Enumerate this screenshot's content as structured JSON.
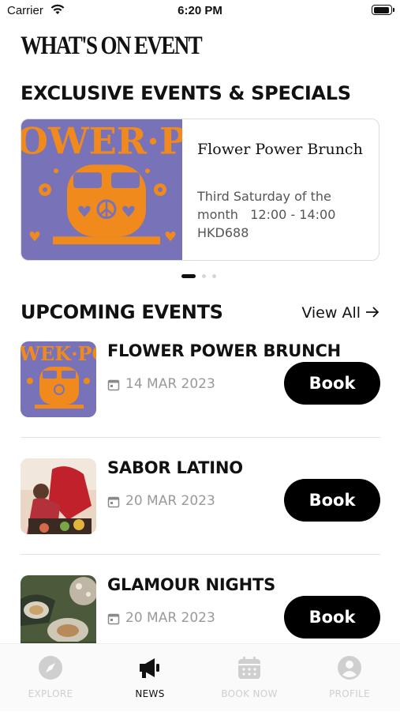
{
  "status_bar": {
    "carrier": "Carrier",
    "time": "6:20 PM"
  },
  "page_title": "WHAT'S ON EVENT",
  "sections": {
    "exclusive": "EXCLUSIVE EVENTS & SPECIALS",
    "upcoming": "UPCOMING EVENTS",
    "view_all": "View All"
  },
  "featured": {
    "title": "Flower Power Brunch",
    "schedule": "Third Saturday of the month",
    "time": "12:00 - 14:00",
    "price": "HKD688",
    "pager": {
      "count": 3,
      "active": 0
    }
  },
  "events": [
    {
      "name": "FLOWER POWER BRUNCH",
      "date": "14 MAR 2023",
      "book_label": "Book",
      "thumb": "flower-power-poster"
    },
    {
      "name": "SABOR LATINO",
      "date": "20 MAR 2023",
      "book_label": "Book",
      "thumb": "latin-dance-photo"
    },
    {
      "name": "GLAMOUR NIGHTS",
      "date": "20 MAR 2023",
      "book_label": "Book",
      "thumb": "oyster-disco-photo"
    }
  ],
  "tabs": [
    {
      "label": "EXPLORE",
      "icon": "compass-icon",
      "active": false
    },
    {
      "label": "NEWS",
      "icon": "megaphone-icon",
      "active": true
    },
    {
      "label": "BOOK NOW",
      "icon": "calendar-icon",
      "active": false
    },
    {
      "label": "PROFILE",
      "icon": "user-icon",
      "active": false
    }
  ],
  "colors": {
    "accent": "#000000",
    "poster_purple": "#7873b8",
    "poster_orange": "#f08a1c",
    "inactive": "#cfcfcf"
  }
}
